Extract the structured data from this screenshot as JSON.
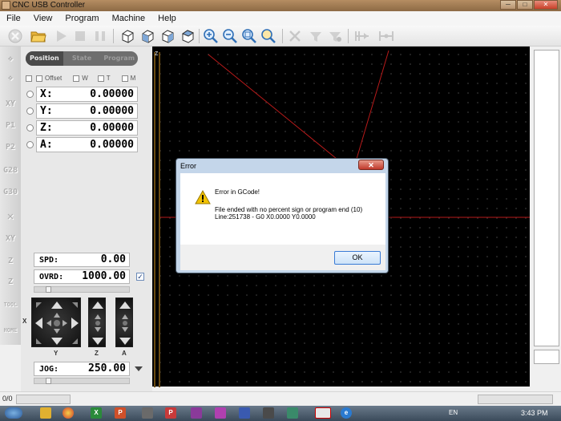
{
  "window": {
    "title": "CNC USB Controller",
    "buttons": {
      "minimize": "─",
      "maximize": "□",
      "close": "✕"
    }
  },
  "menu": [
    "File",
    "View",
    "Program",
    "Machine",
    "Help"
  ],
  "toolbar": {
    "groups": [
      {
        "name": "program",
        "items": [
          "stop-icon",
          "open-folder-icon",
          "play-icon",
          "stop-square-icon",
          "pause-icon"
        ]
      },
      {
        "name": "views",
        "items": [
          "cube-view-1-icon",
          "cube-view-2-icon",
          "cube-view-3-icon",
          "cube-view-4-icon"
        ]
      },
      {
        "name": "zoom",
        "items": [
          "zoom-in-icon",
          "zoom-out-icon",
          "zoom-fit-icon",
          "zoom-window-icon"
        ]
      },
      {
        "name": "tools",
        "items": [
          "tool-1-icon",
          "tool-2-icon",
          "tool-3-icon",
          "grid-1-icon",
          "grid-2-icon"
        ]
      }
    ]
  },
  "rail": [
    "XY",
    "P1",
    "P2",
    "G28",
    "G30",
    "XY",
    "Z",
    "Z",
    "TOOL",
    "HOME"
  ],
  "panel": {
    "tabs": [
      "Position",
      "State",
      "Program"
    ],
    "active_tab": "Position",
    "offset_checks": [
      "Offset",
      "W",
      "T",
      "M"
    ],
    "axes": [
      {
        "label": "X:",
        "value": "0.00000"
      },
      {
        "label": "Y:",
        "value": "0.00000"
      },
      {
        "label": "Z:",
        "value": "0.00000"
      },
      {
        "label": "A:",
        "value": "0.00000"
      }
    ],
    "spd": {
      "label": "SPD:",
      "value": "0.00"
    },
    "ovrd": {
      "label": "OVRD:",
      "value": "1000.00",
      "checked": true
    },
    "jog": {
      "label": "JOG:",
      "value": "250.00"
    },
    "jog_labels": {
      "x": "X",
      "y": "Y",
      "z": "Z",
      "a": "A"
    }
  },
  "viewport": {
    "axis_label": "Z",
    "background": "#000000",
    "path_color": "#cc2222"
  },
  "dialog": {
    "title": "Error",
    "icon": "warning-icon",
    "message_title": "Error in GCode!",
    "message_line1": "File ended with no percent sign or program end (10)",
    "message_line2": "Line:251738 - G0 X0.0000 Y0.0000",
    "ok_label": "OK"
  },
  "status": {
    "text": "0/0"
  },
  "taskbar": {
    "lang": "EN",
    "time": "3:43 PM"
  },
  "colors": {
    "accent": "#3a7bd5",
    "warning": "#f2c200",
    "titlebar": "#a07850"
  }
}
